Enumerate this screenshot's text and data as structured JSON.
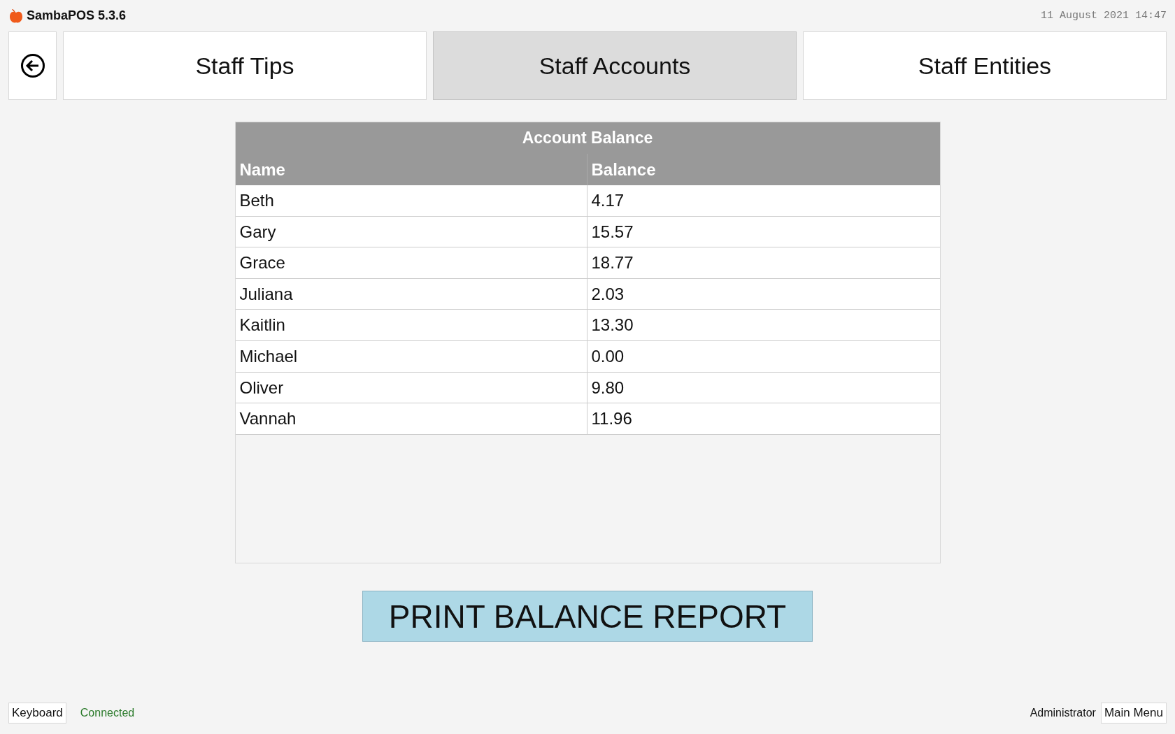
{
  "app": {
    "title": "SambaPOS 5.3.6",
    "datetime": "11 August 2021 14:47"
  },
  "tabs": [
    {
      "label": "Staff Tips",
      "selected": false
    },
    {
      "label": "Staff Accounts",
      "selected": true
    },
    {
      "label": "Staff Entities",
      "selected": false
    }
  ],
  "table": {
    "title": "Account Balance",
    "columns": [
      "Name",
      "Balance"
    ],
    "rows": [
      [
        "Beth",
        "4.17"
      ],
      [
        "Gary",
        "15.57"
      ],
      [
        "Grace",
        "18.77"
      ],
      [
        "Juliana",
        "2.03"
      ],
      [
        "Kaitlin",
        "13.30"
      ],
      [
        "Michael",
        "0.00"
      ],
      [
        "Oliver",
        "9.80"
      ],
      [
        "Vannah",
        "11.96"
      ]
    ]
  },
  "print_button": "PRINT BALANCE REPORT",
  "status_bar": {
    "keyboard": "Keyboard",
    "connection": "Connected",
    "user": "Administrator",
    "main_menu": "Main Menu"
  }
}
